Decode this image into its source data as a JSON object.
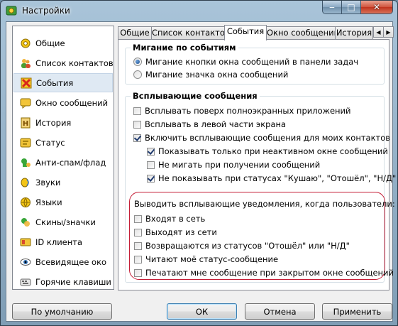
{
  "window": {
    "title": "Настройки",
    "icon": "settings-app-icon"
  },
  "titlebar_buttons": [
    "minimize-icon",
    "maximize-icon",
    "close-icon"
  ],
  "sidebar": {
    "items": [
      {
        "label": "Общие",
        "icon": "general-icon"
      },
      {
        "label": "Список контактов",
        "icon": "contacts-icon"
      },
      {
        "label": "События",
        "icon": "events-icon",
        "selected": true
      },
      {
        "label": "Окно сообщений",
        "icon": "message-window-icon"
      },
      {
        "label": "История",
        "icon": "history-icon"
      },
      {
        "label": "Статус",
        "icon": "status-icon"
      },
      {
        "label": "Анти-спам/флад",
        "icon": "antispam-icon"
      },
      {
        "label": "Звуки",
        "icon": "sound-icon"
      },
      {
        "label": "Языки",
        "icon": "language-icon"
      },
      {
        "label": "Скины/значки",
        "icon": "skins-icon"
      },
      {
        "label": "ID клиента",
        "icon": "client-id-icon"
      },
      {
        "label": "Всевидящее око",
        "icon": "eye-icon"
      },
      {
        "label": "Горячие клавиши",
        "icon": "hotkeys-icon"
      }
    ]
  },
  "tabs": [
    {
      "label": "Общие"
    },
    {
      "label": "Список контактов"
    },
    {
      "label": "События",
      "active": true
    },
    {
      "label": "Окно сообщений"
    },
    {
      "label": "История"
    }
  ],
  "blink": {
    "title": "Мигание по событиям",
    "options": [
      {
        "label": "Мигание кнопки окна сообщений в панели задач",
        "selected": true
      },
      {
        "label": "Мигание значка окна сообщений",
        "selected": false
      }
    ]
  },
  "popups": {
    "title": "Всплывающие сообщения",
    "options": [
      {
        "label": "Всплывать поверх полноэкранных приложений",
        "checked": false
      },
      {
        "label": "Всплывать в левой части экрана",
        "checked": false
      },
      {
        "label": "Включить всплывающие сообщения для моих контактов",
        "checked": true
      },
      {
        "label": "Показывать только при неактивном окне сообщений",
        "checked": true
      },
      {
        "label": "Не мигать при получении сообщений",
        "checked": false
      },
      {
        "label": "Не показывать при статусах \"Кушаю\", \"Отошёл\", \"Н/Д\"",
        "checked": true
      }
    ],
    "notify_heading": "Выводить всплывающие уведомления, когда пользователи:",
    "notify_options": [
      {
        "label": "Входят в сеть",
        "checked": false
      },
      {
        "label": "Выходят из сети",
        "checked": false
      },
      {
        "label": "Возвращаются из статусов \"Отошёл\" или \"Н/Д\"",
        "checked": false
      },
      {
        "label": "Читают моё статус-сообщение",
        "checked": false
      },
      {
        "label": "Печатают мне сообщение при закрытом окне сообщений",
        "checked": false
      }
    ]
  },
  "buttons": {
    "defaults": "По умолчанию",
    "ok": "ОК",
    "cancel": "Отмена",
    "apply": "Применить"
  },
  "colors": {
    "highlight_ring": "#c41d36",
    "selection": "#dfe9f3",
    "window_frame": "#8fabc2"
  }
}
